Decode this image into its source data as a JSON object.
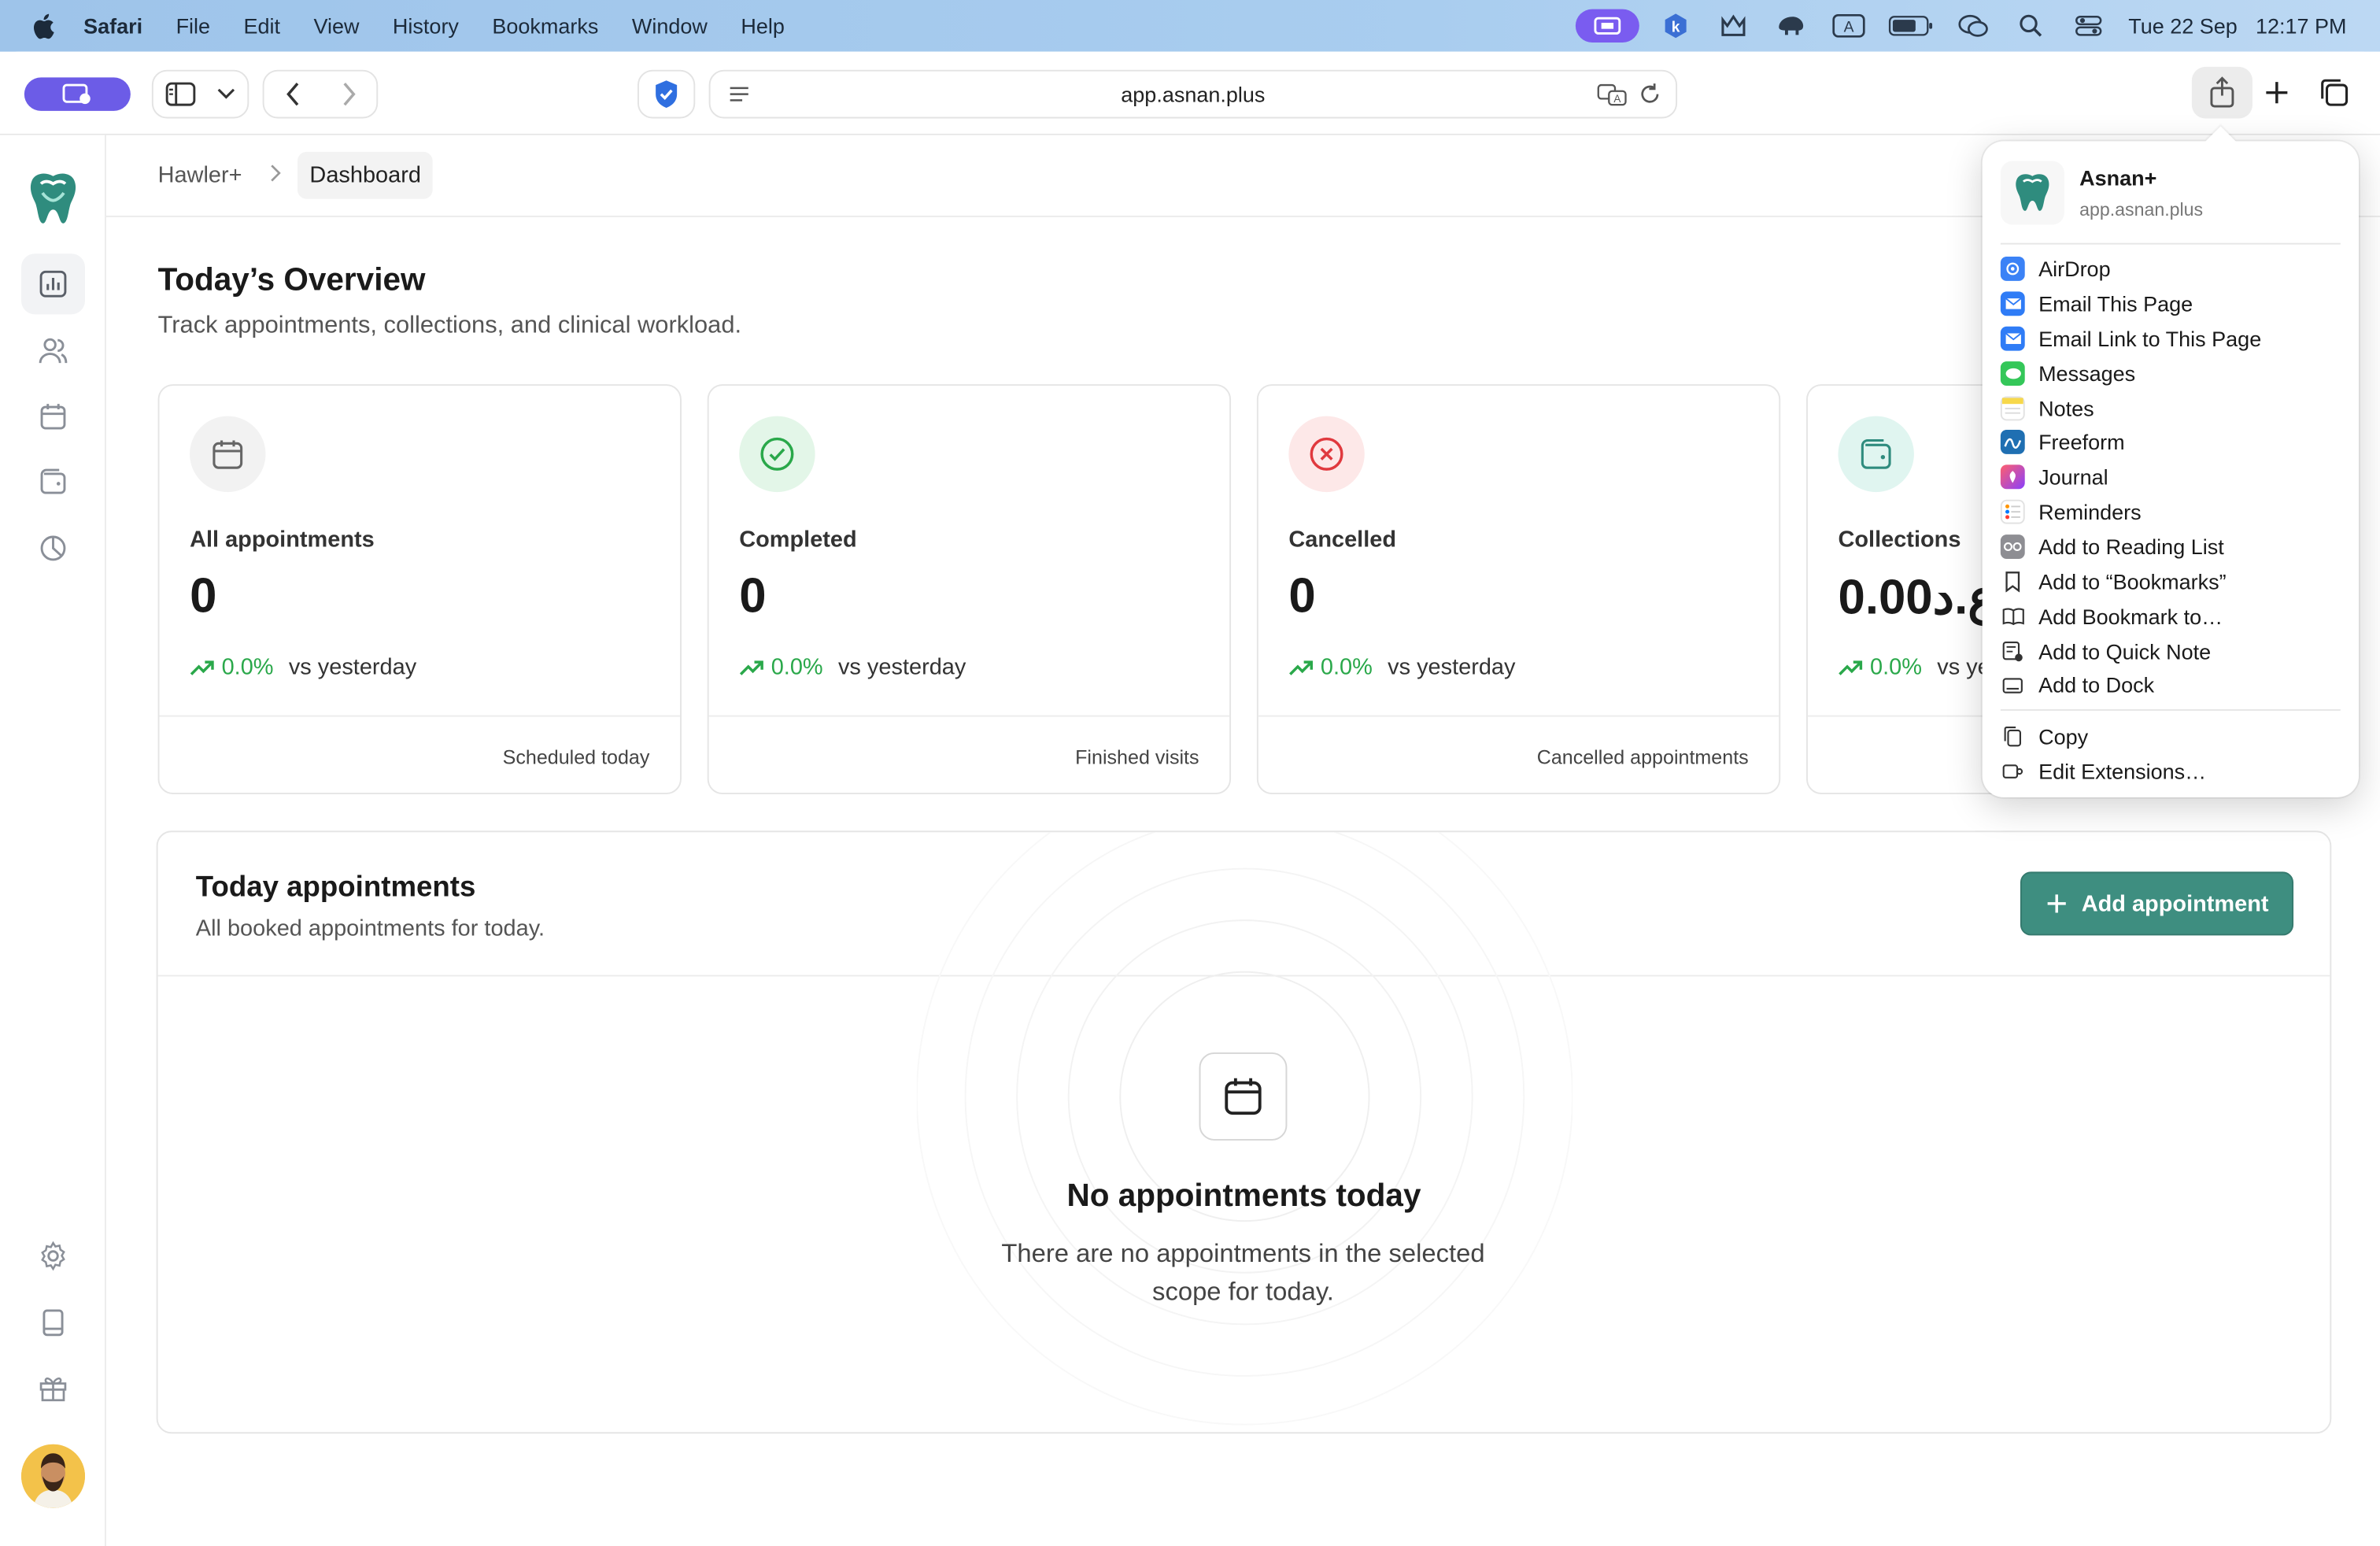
{
  "menubar": {
    "app_name": "Safari",
    "menus": [
      "File",
      "Edit",
      "View",
      "History",
      "Bookmarks",
      "Window",
      "Help"
    ],
    "date": "Tue 22 Sep",
    "time": "12:17 PM",
    "battery": "69"
  },
  "browser": {
    "url": "app.asnan.plus"
  },
  "breadcrumb": {
    "root": "Hawler+",
    "current": "Dashboard"
  },
  "overview": {
    "title": "Today’s Overview",
    "subtitle": "Track appointments, collections, and clinical workload."
  },
  "cards": [
    {
      "label": "All appointments",
      "value": "0",
      "trend": "0.0%",
      "trend_text": "vs yesterday",
      "footer": "Scheduled today",
      "icon": "calendar-icon",
      "color": "#f2f2f2"
    },
    {
      "label": "Completed",
      "value": "0",
      "trend": "0.0%",
      "trend_text": "vs yesterday",
      "footer": "Finished visits",
      "icon": "check-circle-icon",
      "color": "#e3f6e8"
    },
    {
      "label": "Cancelled",
      "value": "0",
      "trend": "0.0%",
      "trend_text": "vs yesterday",
      "footer": "Cancelled appointments",
      "icon": "x-circle-icon",
      "color": "#fde8e8"
    },
    {
      "label": "Collections",
      "value": "0.00ع.د",
      "trend": "0.0%",
      "trend_text": "vs yesterday",
      "footer": "",
      "icon": "wallet-icon",
      "color": "#e0f5f0"
    }
  ],
  "appointments": {
    "title": "Today appointments",
    "subtitle": "All booked appointments for today.",
    "add_label": "Add appointment",
    "empty_title": "No appointments today",
    "empty_text": "There are no appointments in the selected scope for today."
  },
  "share_menu": {
    "app_name": "Asnan+",
    "app_url": "app.asnan.plus",
    "items": [
      {
        "label": "AirDrop",
        "icon": "airdrop-icon",
        "color": "#3b82f6"
      },
      {
        "label": "Email This Page",
        "icon": "mail-icon",
        "color": "#2f7cf6"
      },
      {
        "label": "Email Link to This Page",
        "icon": "mail-icon",
        "color": "#2f7cf6"
      },
      {
        "label": "Messages",
        "icon": "messages-icon",
        "color": "#34c759"
      },
      {
        "label": "Notes",
        "icon": "notes-icon",
        "color": "#f7e9a0"
      },
      {
        "label": "Freeform",
        "icon": "freeform-icon",
        "color": "#1f6fb2"
      },
      {
        "label": "Journal",
        "icon": "journal-icon",
        "color": "#8a3ffc"
      },
      {
        "label": "Reminders",
        "icon": "reminders-icon",
        "color": "#ffffff"
      },
      {
        "label": "Add to Reading List",
        "icon": "glasses-icon",
        "color": "#8e8e93"
      },
      {
        "label": "Add to “Bookmarks”",
        "icon": "bookmark-icon",
        "color": "#ffffff"
      },
      {
        "label": "Add Bookmark to…",
        "icon": "book-icon",
        "color": "#ffffff"
      },
      {
        "label": "Add to Quick Note",
        "icon": "quick-note-icon",
        "color": "#ffffff"
      },
      {
        "label": "Add to Dock",
        "icon": "dock-icon",
        "color": "#ffffff"
      }
    ],
    "copy_label": "Copy",
    "extensions_label": "Edit Extensions…"
  },
  "colors": {
    "accent": "#3e8e80",
    "positive": "#2aa84a",
    "danger": "#e0393e"
  }
}
